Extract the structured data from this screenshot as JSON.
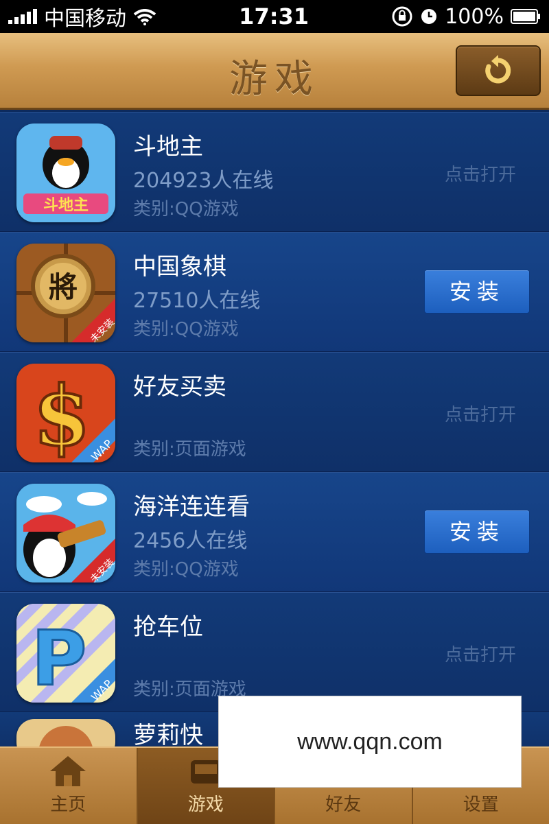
{
  "status_bar": {
    "carrier": "中国移动",
    "time": "17:31",
    "battery": "100%"
  },
  "header": {
    "title": "游戏",
    "refresh_icon": "refresh-icon"
  },
  "games": [
    {
      "name": "斗地主",
      "online": "204923人在线",
      "category": "类别:QQ游戏",
      "action": "点击打开",
      "action_type": "open",
      "icon": "doudizhu-icon"
    },
    {
      "name": "中国象棋",
      "online": "27510人在线",
      "category": "类别:QQ游戏",
      "action": "安装",
      "action_type": "install",
      "icon": "xiangqi-icon",
      "badge": "未安装"
    },
    {
      "name": "好友买卖",
      "online": "",
      "category": "类别:页面游戏",
      "action": "点击打开",
      "action_type": "open",
      "icon": "dollar-icon",
      "badge": "WAP"
    },
    {
      "name": "海洋连连看",
      "online": "2456人在线",
      "category": "类别:QQ游戏",
      "action": "安装",
      "action_type": "install",
      "icon": "ocean-icon",
      "badge": "未安装"
    },
    {
      "name": "抢车位",
      "online": "",
      "category": "类别:页面游戏",
      "action": "点击打开",
      "action_type": "open",
      "icon": "parking-icon",
      "badge": "WAP"
    },
    {
      "name": "萝莉快",
      "partial": true
    }
  ],
  "tabs": [
    {
      "label": "主页",
      "icon": "home-icon"
    },
    {
      "label": "游戏",
      "icon": "game-icon",
      "active": true
    },
    {
      "label": "好友",
      "icon": "friends-icon"
    },
    {
      "label": "设置",
      "icon": "settings-icon"
    }
  ],
  "watermark": "www.qqn.com",
  "colors": {
    "list_bg": "#0c2a5e",
    "wood_header": "#cf9a52",
    "install_button": "#2a6fd0"
  }
}
